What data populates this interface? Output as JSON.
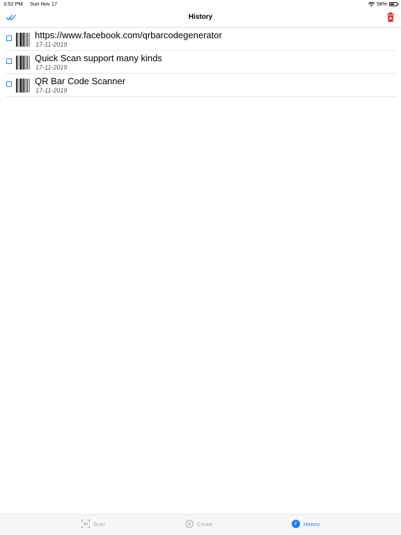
{
  "status_bar": {
    "time": "3:52 PM",
    "date": "Sun Nov 17",
    "battery": "58%",
    "battery_level": 0.58
  },
  "nav": {
    "title": "History",
    "left_icon": "double-check-icon",
    "right_icon": "trash-icon"
  },
  "history": [
    {
      "title": "https://www.facebook.com/qrbarcodegenerator",
      "date": "17-11-2019"
    },
    {
      "title": "Quick Scan support many kinds",
      "date": "17-11-2019"
    },
    {
      "title": "QR Bar Code Scanner",
      "date": "17-11-2019"
    }
  ],
  "tabs": [
    {
      "label": "Scan",
      "icon": "scan-icon",
      "active": false
    },
    {
      "label": "Create",
      "icon": "create-icon",
      "active": false
    },
    {
      "label": "History",
      "icon": "clock-icon",
      "active": true
    }
  ],
  "colors": {
    "accent": "#1d7ff0",
    "danger": "#e0252b",
    "inactive": "#a7a7a7"
  }
}
